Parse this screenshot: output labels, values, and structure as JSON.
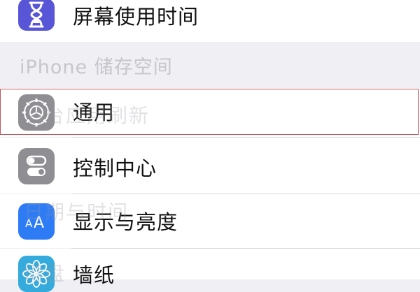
{
  "settings": {
    "screen_time_label": "屏幕使用时间",
    "storage_header": "iPhone 储存空间",
    "items": [
      {
        "label": "通用",
        "icon": "gear-icon",
        "color": "#8e8e93"
      },
      {
        "label": "控制中心",
        "icon": "toggle-icon",
        "color": "#8e8e93"
      },
      {
        "label": "显示与亮度",
        "icon": "text-size-icon",
        "color": "#2d7cf6"
      },
      {
        "label": "墙纸",
        "icon": "flower-icon",
        "color": "#35aadc"
      }
    ],
    "ghost_text": {
      "background_refresh": "后台应用刷新",
      "date_time": "日期与时间",
      "keyboard": "键盘"
    }
  }
}
